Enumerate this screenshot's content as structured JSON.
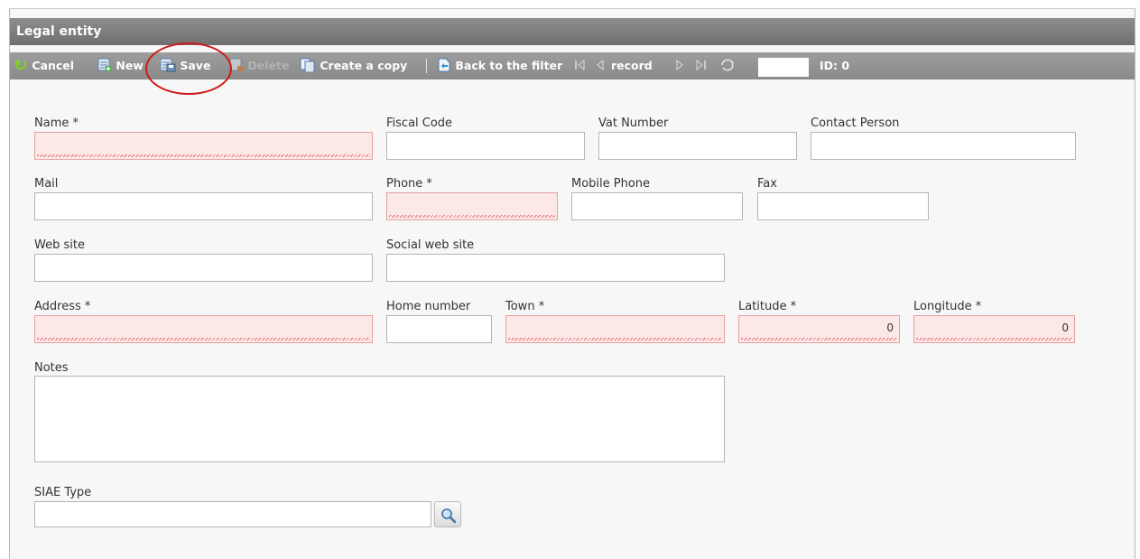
{
  "window": {
    "title": "Legal entity"
  },
  "toolbar": {
    "cancel": "Cancel",
    "new": "New",
    "save": "Save",
    "delete": "Delete",
    "copy": "Create a copy",
    "back": "Back to the filter",
    "record": "record",
    "record_value": "",
    "id": "ID: 0"
  },
  "form": {
    "name": {
      "label": "Name *",
      "value": ""
    },
    "fiscal_code": {
      "label": "Fiscal Code",
      "value": ""
    },
    "vat_number": {
      "label": "Vat Number",
      "value": ""
    },
    "contact_person": {
      "label": "Contact Person",
      "value": ""
    },
    "mail": {
      "label": "Mail",
      "value": ""
    },
    "phone": {
      "label": "Phone *",
      "value": ""
    },
    "mobile_phone": {
      "label": "Mobile Phone",
      "value": ""
    },
    "fax": {
      "label": "Fax",
      "value": ""
    },
    "web_site": {
      "label": "Web site",
      "value": ""
    },
    "social_web_site": {
      "label": "Social web site",
      "value": ""
    },
    "address": {
      "label": "Address *",
      "value": ""
    },
    "home_number": {
      "label": "Home number",
      "value": ""
    },
    "town": {
      "label": "Town *",
      "value": ""
    },
    "latitude": {
      "label": "Latitude *",
      "value": "0"
    },
    "longitude": {
      "label": "Longitude *",
      "value": "0"
    },
    "notes": {
      "label": "Notes",
      "value": ""
    },
    "siae_type": {
      "label": "SIAE Type",
      "value": ""
    }
  },
  "colors": {
    "titlebar": "#7f7f7f",
    "toolbar": "#939393",
    "required_bg": "#fde8e8",
    "required_border": "#e3a0a0",
    "annotation": "#d01818"
  },
  "icons": [
    "cancel-icon",
    "new-icon",
    "save-icon",
    "delete-icon",
    "copy-icon",
    "back-icon",
    "first-record-icon",
    "previous-record-icon",
    "next-record-icon",
    "last-record-icon",
    "refresh-icon",
    "search-icon"
  ]
}
